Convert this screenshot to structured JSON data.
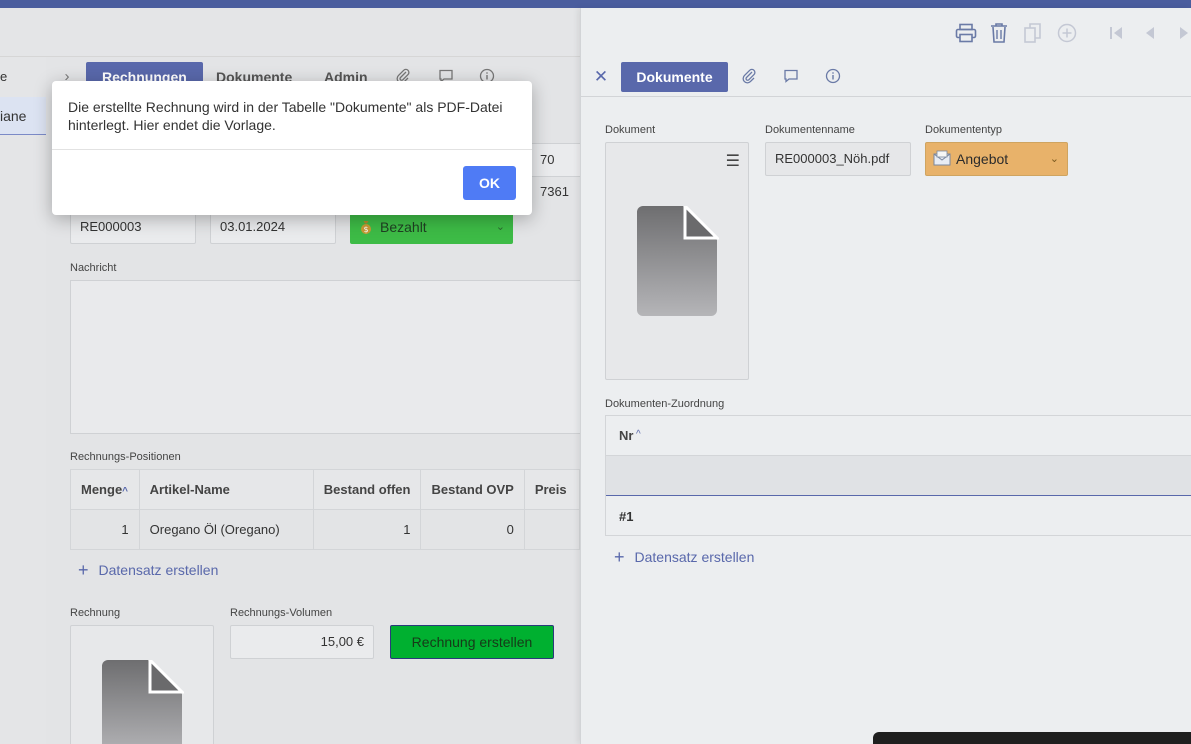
{
  "colors": {
    "top_strip": "#4a5d9e",
    "accent": "#5968ab",
    "ok_button": "#4f7bf5",
    "status_paid": "#3dbb46",
    "create_button": "#00b030",
    "doc_type": "#e8b26a"
  },
  "leftnav": {
    "frag_top": "e",
    "frag_selected": "iane"
  },
  "main": {
    "tabs": [
      {
        "label": "Rechnungen",
        "active": true
      },
      {
        "label": "Dokumente",
        "active": false
      },
      {
        "label": "Admin",
        "active": false
      }
    ],
    "tab_icons": [
      "paperclip-icon",
      "comment-icon",
      "info-icon"
    ],
    "phone_fragment": "70 7361",
    "invoice_number": "RE000003",
    "invoice_date": "03.01.2024",
    "status": "Bezahlt",
    "message_label": "Nachricht",
    "message_value": "",
    "positions_label": "Rechnungs-Positionen",
    "positions_columns": [
      "Menge",
      "Artikel-Name",
      "Bestand offen",
      "Bestand OVP",
      "Preis"
    ],
    "positions_rows": [
      {
        "menge": "1",
        "artikel": "Oregano Öl (Oregano)",
        "bestand_offen": "1",
        "bestand_ovp": "0",
        "preis": ""
      }
    ],
    "add_record": "Datensatz erstellen",
    "invoice_doc_label": "Rechnung",
    "volume_label": "Rechnungs-Volumen",
    "volume_value": "15,00 €",
    "create_button": "Rechnung erstellen"
  },
  "right_panel": {
    "toolbar_icons": [
      "print-icon",
      "trash-icon",
      "copy-icon",
      "add-circle-icon",
      "first-page-icon",
      "prev-icon",
      "next-icon"
    ],
    "tab_active": "Dokumente",
    "document_label": "Dokument",
    "docname_label": "Dokumentenname",
    "docname_value": "RE000003_Nöh.pdf",
    "doctype_label": "Dokumententyp",
    "doctype_value": "Angebot",
    "assignment_label": "Dokumenten-Zuordnung",
    "assignment_column": "Nr",
    "assignment_rows": [
      "#1"
    ],
    "add_record": "Datensatz erstellen"
  },
  "dialog": {
    "message": "Die erstellte Rechnung wird in der Tabelle \"Dokumente\" als PDF-Datei hinterlegt. Hier endet die Vorlage.",
    "ok_label": "OK"
  }
}
